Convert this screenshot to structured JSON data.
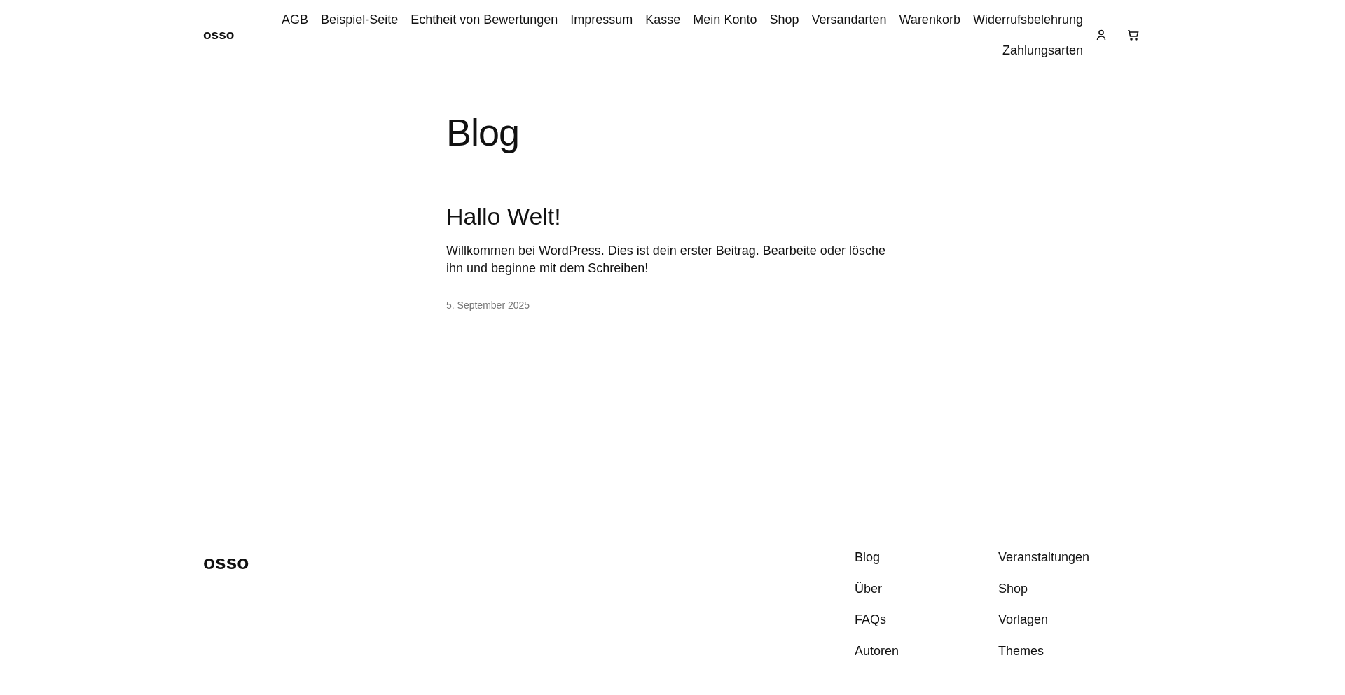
{
  "header": {
    "logo": "osso",
    "nav": [
      "AGB",
      "Beispiel-Seite",
      "Echtheit von Bewertungen",
      "Impressum",
      "Kasse",
      "Mein Konto",
      "Shop",
      "Versandarten",
      "Warenkorb",
      "Widerrufsbelehrung",
      "Zahlungsarten"
    ]
  },
  "main": {
    "title": "Blog",
    "posts": [
      {
        "title": "Hallo Welt!",
        "excerpt": "Willkommen bei WordPress. Dies ist dein erster Beitrag. Bearbeite oder lösche ihn und beginne mit dem Schreiben!",
        "date": "5. September 2025"
      }
    ]
  },
  "footer": {
    "logo": "osso",
    "columns": [
      [
        "Blog",
        "Über",
        "FAQs",
        "Autoren"
      ],
      [
        "Veranstaltungen",
        "Shop",
        "Vorlagen",
        "Themes"
      ]
    ]
  }
}
